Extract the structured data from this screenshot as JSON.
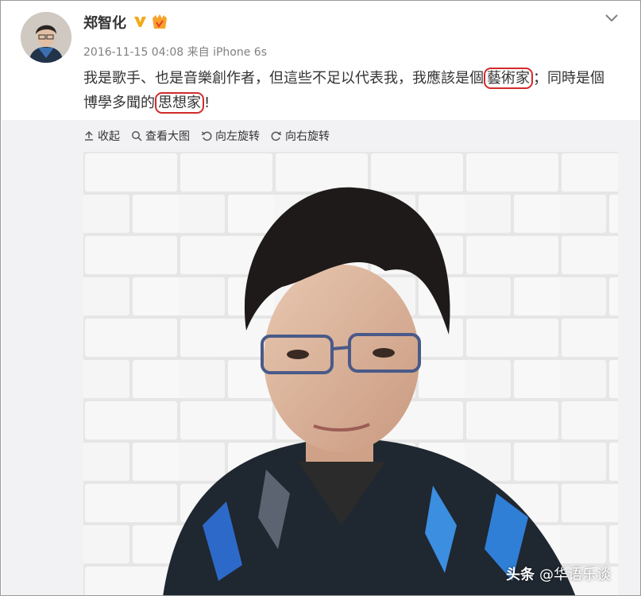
{
  "post": {
    "author": "郑智化",
    "verified_icon": "verified-v-icon",
    "member_icon": "vip-member-icon",
    "timestamp": "2016-11-15 04:08",
    "source": "来自 iPhone 6s",
    "text": {
      "part1": "我是歌手、也是音樂創作者，但這些不足以代表我，我應該是個",
      "circled1": "藝術家",
      "part2": "；同時是個博學多聞的",
      "circled2": "思想家",
      "part3": "!"
    },
    "highlight_color": "#d22b2b"
  },
  "toolbar": {
    "collapse_label": "收起",
    "view_large_label": "查看大图",
    "rotate_left_label": "向左旋转",
    "rotate_right_label": "向右旋转"
  },
  "watermark": {
    "logo": "头条",
    "account": "@华语乐谈"
  },
  "colors": {
    "text": "#333333",
    "meta": "#808080",
    "media_background": "#f2f2f5",
    "verified": "#f2a91b"
  }
}
